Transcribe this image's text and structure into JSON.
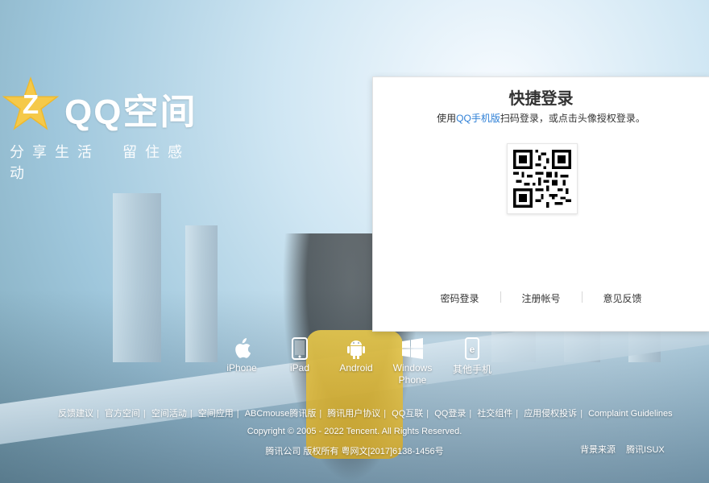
{
  "brand": {
    "logo_text": "QQ空间",
    "slogan": "分享生活　留住感动",
    "star_color": "#f5c94a",
    "z_color": "#ffffff"
  },
  "login": {
    "title": "快捷登录",
    "desc_prefix": "使用",
    "desc_link": "QQ手机版",
    "desc_suffix": "扫码登录，或点击头像授权登录。",
    "links": [
      "密码登录",
      "注册帐号",
      "意见反馈"
    ]
  },
  "platforms": [
    {
      "label": "iPhone",
      "icon": "apple-icon"
    },
    {
      "label": "iPad",
      "icon": "ipad-icon"
    },
    {
      "label": "Android",
      "icon": "android-icon"
    },
    {
      "label": "Windows\nPhone",
      "icon": "windows-icon"
    },
    {
      "label": "其他手机",
      "icon": "phone-icon"
    }
  ],
  "footer": {
    "links": [
      "反馈建议",
      "官方空间",
      "空间活动",
      "空间应用",
      "ABCmouse腾讯版",
      "腾讯用户协议",
      "QQ互联",
      "QQ登录",
      "社交组件",
      "应用侵权投诉",
      "Complaint Guidelines"
    ],
    "copyright": "Copyright © 2005 - 2022 Tencent. All Rights Reserved.",
    "company": "腾讯公司 版权所有 粤网文[2017]6138-1456号",
    "credits": [
      "背景来源",
      "腾讯ISUX"
    ]
  },
  "colors": {
    "link_blue": "#2d7fd6",
    "panel_bg": "#ffffff"
  }
}
